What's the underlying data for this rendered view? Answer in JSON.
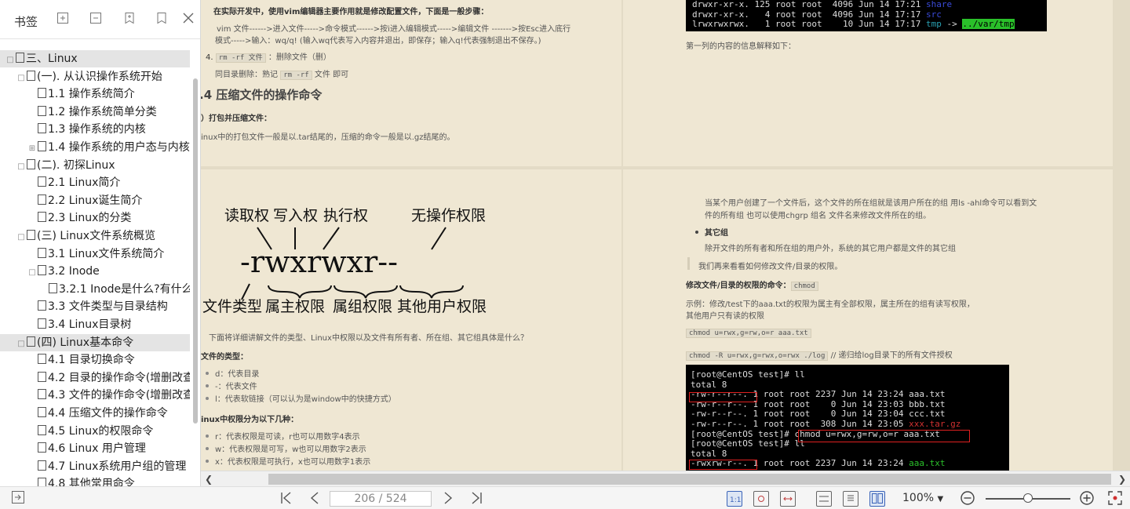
{
  "sidebar": {
    "title": "书签",
    "tools": [
      "add-bookmark-icon",
      "expand-bookmark-icon",
      "bookmark-add-icon",
      "bookmark-icon",
      "close-icon"
    ],
    "tree": [
      {
        "label": "三、Linux",
        "level": 0,
        "expander": "□",
        "selected": true
      },
      {
        "label": "(一). 从认识操作系统开始",
        "level": 1,
        "expander": "□"
      },
      {
        "label": "1.1 操作系统简介",
        "level": 2,
        "expander": ""
      },
      {
        "label": "1.2 操作系统简单分类",
        "level": 2,
        "expander": ""
      },
      {
        "label": "1.3 操作系统的内核",
        "level": 2,
        "expander": ""
      },
      {
        "label": "1.4 操作系统的用户态与内核",
        "level": 2,
        "expander": "⊞"
      },
      {
        "label": "(二). 初探Linux",
        "level": 1,
        "expander": "□"
      },
      {
        "label": "2.1 Linux简介",
        "level": 2,
        "expander": ""
      },
      {
        "label": "2.2 Linux诞生简介",
        "level": 2,
        "expander": ""
      },
      {
        "label": "2.3 Linux的分类",
        "level": 2,
        "expander": ""
      },
      {
        "label": "(三) Linux文件系统概览",
        "level": 1,
        "expander": "□"
      },
      {
        "label": "3.1 Linux文件系统简介",
        "level": 2,
        "expander": ""
      },
      {
        "label": "3.2 Inode",
        "level": 2,
        "expander": "□"
      },
      {
        "label": "3.2.1 Inode是什么?有什么",
        "level": 3,
        "expander": ""
      },
      {
        "label": "3.3 文件类型与目录结构",
        "level": 2,
        "expander": ""
      },
      {
        "label": "3.4 Linux目录树",
        "level": 2,
        "expander": ""
      },
      {
        "label": "(四) Linux基本命令",
        "level": 1,
        "expander": "□",
        "selected": true
      },
      {
        "label": "4.1 目录切换命令",
        "level": 2,
        "expander": ""
      },
      {
        "label": "4.2 目录的操作命令(增删改查)",
        "level": 2,
        "expander": ""
      },
      {
        "label": "4.3 文件的操作命令(增删改查)",
        "level": 2,
        "expander": ""
      },
      {
        "label": "4.4 压缩文件的操作命令",
        "level": 2,
        "expander": ""
      },
      {
        "label": "4.5 Linux的权限命令",
        "level": 2,
        "expander": ""
      },
      {
        "label": "4.6 Linux 用户管理",
        "level": 2,
        "expander": ""
      },
      {
        "label": "4.7 Linux系统用户组的管理",
        "level": 2,
        "expander": ""
      },
      {
        "label": "4.8 其他常用命令",
        "level": 2,
        "expander": ""
      }
    ]
  },
  "doc": {
    "tl": {
      "line1": "在实际开发中，使用vim编辑器主要作用就是修改配置文件，下面是一般步骤：",
      "line2": "vim 文件------>进入文件----->命令模式------>按i进入编辑模式----->编辑文件  ------->按Esc进入底行",
      "line3": "模式----->输入：wq/q!  (输入wq代表写入内容并退出，即保存；输入q!代表强制退出不保存。)",
      "item4_num": "4.",
      "item4_code": "rm -rf 文件",
      "item4_text": "：删除文件（删）",
      "line5_pre": "同目录删除：熟记",
      "line5_code": "rm -rf",
      "line5_post": "文件 即可",
      "heading": ".4 压缩文件的操作命令",
      "sub": "）打包并压缩文件：",
      "line6": "inux中的打包文件一般是以.tar结尾的，压缩的命令一般是以.gz结尾的。"
    },
    "tr": {
      "term_lines": [
        {
          "perm": "drwxr-xr-x. 125 root root  4096 Jun 14 17:21 ",
          "name": "share",
          "cls": "t-blue"
        },
        {
          "perm": "drwxr-xr-x.   4 root root  4096 Jun 14 17:17 ",
          "name": "src",
          "cls": "t-blue"
        },
        {
          "perm": "lrwxrwxrwx.   1 root root    10 Jun 14 17:17 ",
          "name": "tmp",
          "cls": "t-cyan",
          "arrow": " -> ",
          "target": "../var/tmp"
        }
      ],
      "caption": "第一列的内容的信息解释如下："
    },
    "bl": {
      "labels": {
        "read": "读取权",
        "write": "写入权",
        "exec": "执行权",
        "none": "无操作权限",
        "filetype": "文件类型",
        "owner": "属主权限",
        "group": "属组权限",
        "other": "其他用户权限"
      },
      "perm_string": "-rwxrwxr--",
      "intro": "下面将详细讲解文件的类型、Linux中权限以及文件有所有者、所在组、其它组具体是什么？",
      "types_title": "文件的类型：",
      "types": [
        "d：代表目录",
        "-：代表文件",
        "l：代表软链接（可以认为是window中的快捷方式）"
      ],
      "perm_title": "inux中权限分为以下几种：",
      "perms": [
        "r：代表权限是可读，r也可以用数字4表示",
        "w：代表权限是可写，w也可以用数字2表示",
        "x：代表权限是可执行，x也可以用数字1表示"
      ]
    },
    "br": {
      "para1a": "当某个用户创建了一个文件后，这个文件的所在组就是该用户所在的组 用ls -ahl命令可以看到文",
      "para1b": "件的所有组 也可以使用chgrp  组名  文件名来修改文件所在的组。",
      "bullet": "其它组",
      "para2": "除开文件的所有者和所在组的用户外，系统的其它用户都是文件的其它组",
      "quote": "我们再来看看如何修改文件/目录的权限。",
      "cmd_title": "修改文件/目录的权限的命令：",
      "cmd_code": "chmod",
      "example1": "示例：修改/test下的aaa.txt的权限为属主有全部权限，属主所在的组有读写权限，",
      "example2": "其他用户只有读的权限",
      "code1": "chmod u=rwx,g=rw,o=r aaa.txt",
      "code2": "chmod -R u=rwx,g=rwx,o=rwx ./log",
      "code2_note": "// 递归给log目录下的所有文件授权",
      "term_lines": [
        {
          "text": "[root@CentOS test]# ll",
          "name": "",
          "cls": ""
        },
        {
          "text": "total 8",
          "name": "",
          "cls": ""
        },
        {
          "text": "-rw-r--r--. 1 root root 2237 Jun 14 23:24 aaa.txt",
          "name": "",
          "cls": ""
        },
        {
          "text": "-rw-r--r--. 1 root root    0 Jun 14 23:03 bbb.txt",
          "name": "",
          "cls": ""
        },
        {
          "text": "-rw-r--r--. 1 root root    0 Jun 14 23:04 ccc.txt",
          "name": "",
          "cls": ""
        },
        {
          "text": "-rw-r--r--. 1 root root  308 Jun 14 23:05 ",
          "name": "xxx.tar.gz",
          "cls": "t-red"
        },
        {
          "text": "[root@CentOS test]# chmod u=rwx,g=rw,o=r aaa.txt",
          "name": "",
          "cls": ""
        },
        {
          "text": "[root@CentOS test]# ll",
          "name": "",
          "cls": ""
        },
        {
          "text": "total 8",
          "name": "",
          "cls": ""
        },
        {
          "text": "-rwxrw-r--. 1 root root 2237 Jun 14 23:24 ",
          "name": "aaa.txt",
          "cls": "t-green"
        }
      ]
    }
  },
  "bottombar": {
    "page_display": "206 / 524",
    "zoom": "100%",
    "zoom_fraction": 0.5
  }
}
